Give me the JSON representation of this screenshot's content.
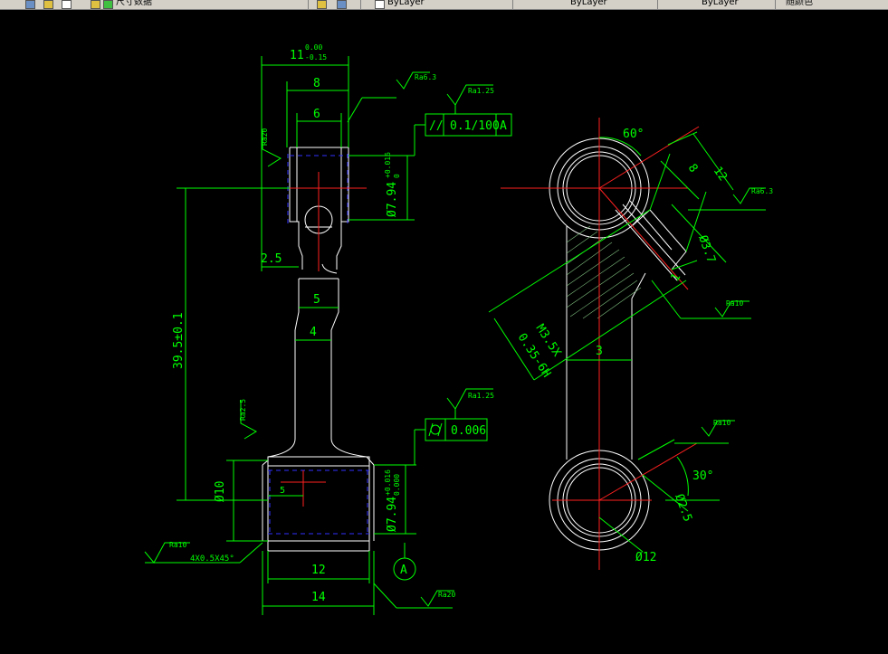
{
  "toolbar": {
    "label_1": "尺寸数据",
    "layer_1": "ByLayer",
    "layer_2": "ByLayer",
    "layer_3": "ByLayer",
    "plot_style": "随颜色"
  },
  "left_view": {
    "dim_overall_width": "11",
    "tol_upper_width": "0.00",
    "tol_lower_width": "-0.15",
    "dim_8": "8",
    "dim_6": "6",
    "dim_2_5": "2.5",
    "dim_5": "5",
    "dim_4": "4",
    "dim_length": "39.5±0.1",
    "dim_12": "12",
    "dim_14": "14",
    "dim_dia10": "Ø10",
    "dim_5_small": "5",
    "hole_top": "Ø7.94",
    "hole_top_tol_u": "+0.016",
    "hole_top_tol_l": "0",
    "hole_bottom": "Ø7.94",
    "hole_bottom_tol_u": "+0.016",
    "hole_bottom_tol_l": "0.000",
    "chamfer": "4X0.5X45°",
    "datum": "A",
    "ra_1": "Ra6.3",
    "ra_2": "Ra1.25",
    "ra_3": "Ra20",
    "ra_4": "Ra2.5",
    "ra_5": "Ra10",
    "ra_6": "Ra1.25",
    "ra_7": "Ra20",
    "fcf_parallel_symbol": "//",
    "fcf_parallel_value": "0.1/100",
    "fcf_parallel_datum": "A",
    "fcf_cyl_value": "0.006"
  },
  "right_view": {
    "angle_60": "60°",
    "dim_8": "8",
    "dim_12": "12",
    "dim_dia3_7": "Ø3.7",
    "dim_1": "1",
    "thread": "M3.5X",
    "thread_2": "0.35-6H",
    "dim_3": "3",
    "angle_30": "30°",
    "dim_dia2_5": "Ø2.5",
    "dim_dia12": "Ø12",
    "ra_1": "Ra6.3",
    "ra_2": "Ra10",
    "ra_3": "Ra10"
  }
}
